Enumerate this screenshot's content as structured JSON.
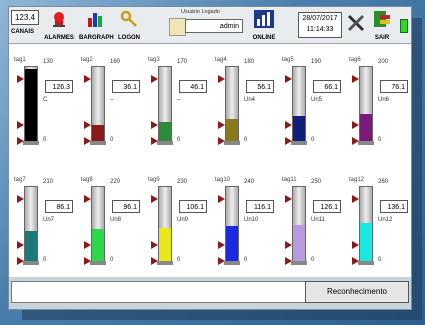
{
  "toolbar": {
    "counter": "123.4",
    "canais": "CANAIS",
    "alarmes": "ALARMES",
    "bargraph": "BARGRAPH",
    "logon": "LOGON",
    "usuario_caption": "Usuário Logado",
    "usuario": "admin",
    "online": "ONLINE",
    "date": "28/07/2017",
    "time": "11:14:33",
    "sair": "SAIR"
  },
  "gauges": [
    {
      "name": "tag1",
      "max": "130",
      "min": "0",
      "value": "126.3",
      "unit": "C",
      "level": 0.97,
      "color": "#000000"
    },
    {
      "name": "tag2",
      "max": "160",
      "min": "0",
      "value": "36.1",
      "unit": "--",
      "level": 0.23,
      "color": "#8b1a1a"
    },
    {
      "name": "tag3",
      "max": "170",
      "min": "0",
      "value": "46.1",
      "unit": "--",
      "level": 0.27,
      "color": "#2e8b3a"
    },
    {
      "name": "tag4",
      "max": "180",
      "min": "0",
      "value": "56.1",
      "unit": "Un4",
      "level": 0.31,
      "color": "#8a7a1a"
    },
    {
      "name": "tag5",
      "max": "190",
      "min": "0",
      "value": "66.1",
      "unit": "Un5",
      "level": 0.35,
      "color": "#10207a"
    },
    {
      "name": "tag6",
      "max": "200",
      "min": "0",
      "value": "76.1",
      "unit": "Un6",
      "level": 0.38,
      "color": "#7a1a7a"
    },
    {
      "name": "tag7",
      "max": "210",
      "min": "0",
      "value": "86.1",
      "unit": "Un7",
      "level": 0.41,
      "color": "#1a7a7a"
    },
    {
      "name": "tag8",
      "max": "220",
      "min": "0",
      "value": "96.1",
      "unit": "Un8",
      "level": 0.44,
      "color": "#2ad84a"
    },
    {
      "name": "tag9",
      "max": "230",
      "min": "0",
      "value": "106.1",
      "unit": "Un9",
      "level": 0.46,
      "color": "#e8e818"
    },
    {
      "name": "tag10",
      "max": "240",
      "min": "0",
      "value": "116.1",
      "unit": "Un10",
      "level": 0.48,
      "color": "#1a2ae0"
    },
    {
      "name": "tag11",
      "max": "250",
      "min": "0",
      "value": "126.1",
      "unit": "Un11",
      "level": 0.5,
      "color": "#b89ae0"
    },
    {
      "name": "tag12",
      "max": "260",
      "min": "0",
      "value": "136.1",
      "unit": "Un12",
      "level": 0.52,
      "color": "#18e8e0"
    }
  ],
  "footer": {
    "status": "",
    "ack_label": "Reconhecimento"
  }
}
